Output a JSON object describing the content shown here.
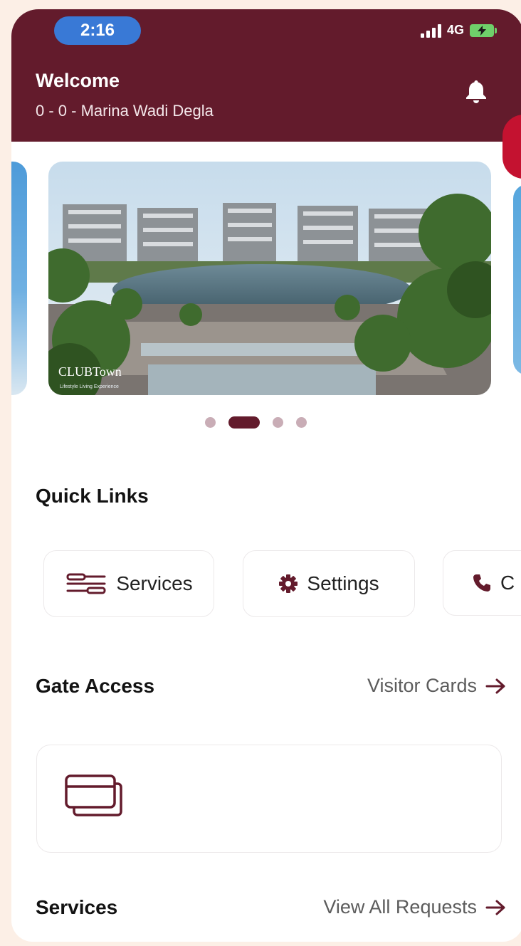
{
  "status_bar": {
    "time": "2:16",
    "network": "4G"
  },
  "header": {
    "title": "Welcome",
    "subtitle": "0 - 0 - Marina Wadi Degla"
  },
  "carousel": {
    "logo_text": "CLUBTown",
    "logo_subtext": "Lifestyle Living Experience",
    "slide_count": 4,
    "active_index": 1
  },
  "quick_links": {
    "title": "Quick Links",
    "items": [
      {
        "label": "Services",
        "icon": "tools-icon"
      },
      {
        "label": "Settings",
        "icon": "gear-icon"
      },
      {
        "label": "C",
        "icon": "phone-icon"
      }
    ]
  },
  "gate_access": {
    "title": "Gate Access",
    "link": "Visitor Cards"
  },
  "services": {
    "title": "Services",
    "link": "View All Requests"
  },
  "colors": {
    "brand": "#631b2c",
    "accent_red": "#c41230",
    "time_pill": "#3979d6",
    "background": "#fcefe6"
  }
}
